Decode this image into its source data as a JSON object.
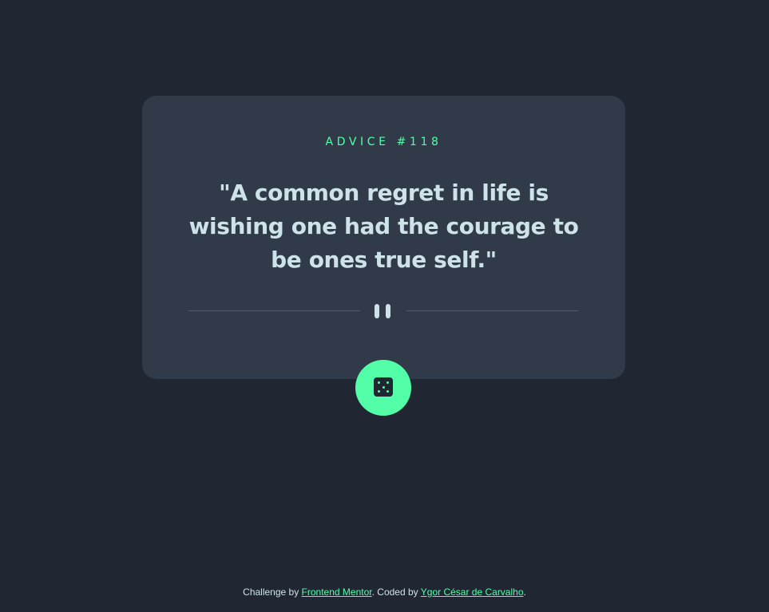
{
  "card": {
    "label": "ADVICE #118",
    "quote": "\"A common regret in life is wishing one had the courage to be ones true self.\""
  },
  "footer": {
    "prefix": "Challenge by ",
    "link1": "Frontend Mentor",
    "middle": ". Coded by ",
    "link2": "Ygor César de Carvalho",
    "suffix": "."
  },
  "colors": {
    "background": "#202632",
    "card": "#313a48",
    "accent": "#52ffa8",
    "text": "#cee3e9",
    "divider": "#4f5d74"
  },
  "icons": {
    "divider": "pause-icon",
    "button": "dice-icon"
  }
}
